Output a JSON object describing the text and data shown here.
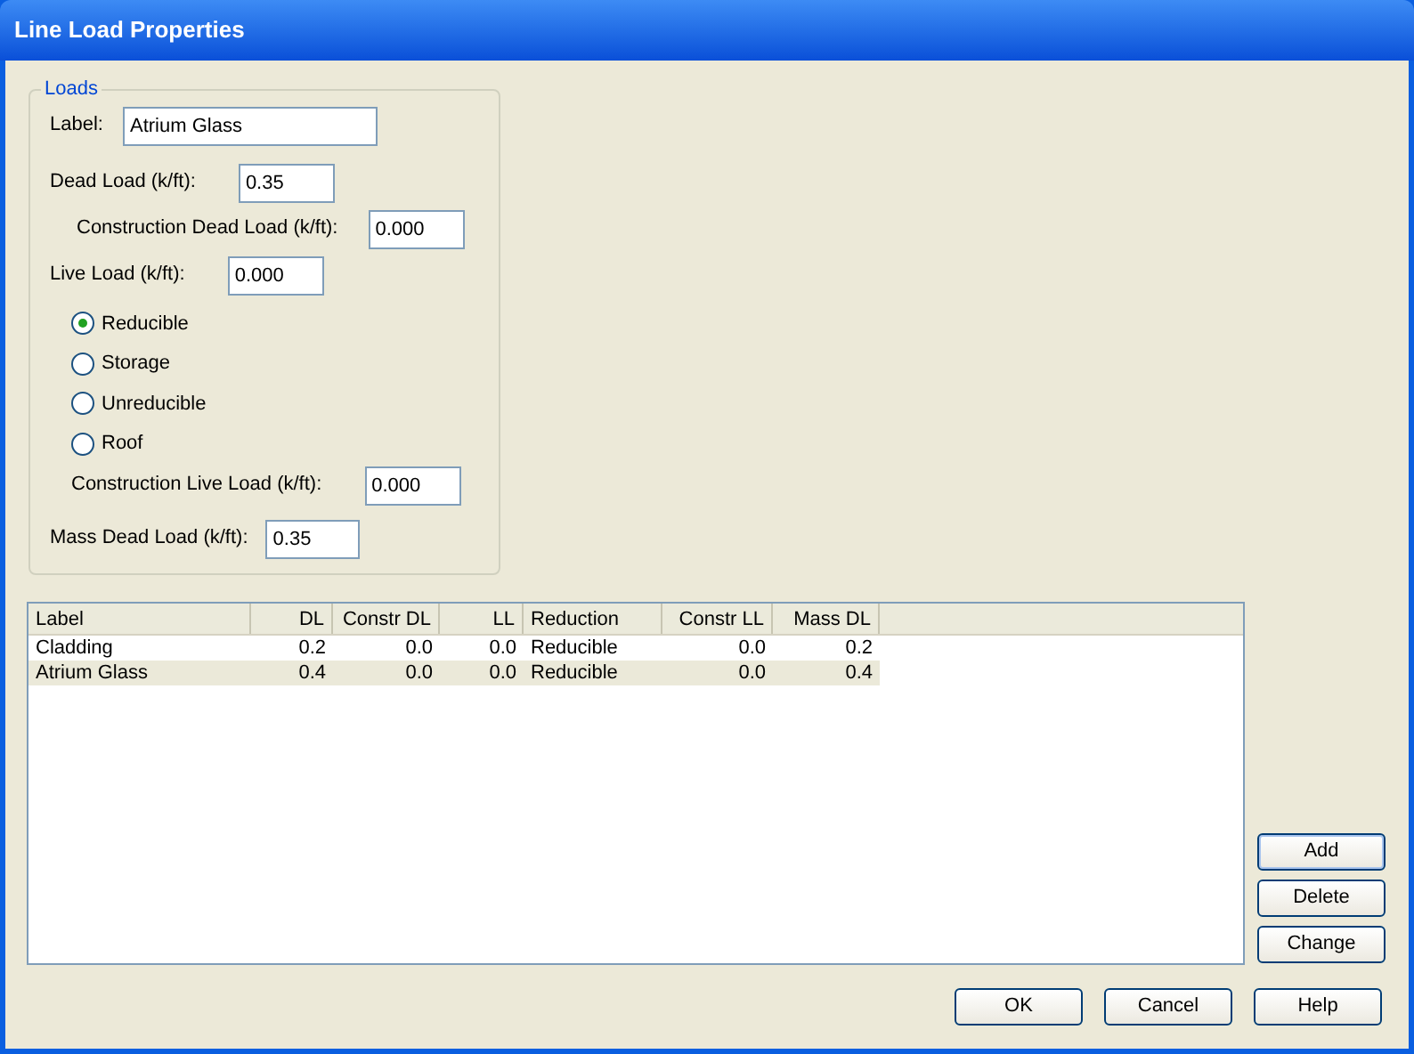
{
  "window": {
    "title": "Line Load Properties"
  },
  "loads": {
    "legend": "Loads",
    "label": {
      "label": "Label:",
      "value": "Atrium Glass"
    },
    "dead_load": {
      "label": "Dead Load (k/ft):",
      "value": "0.35"
    },
    "construction_dead_load": {
      "label": "Construction Dead Load (k/ft):",
      "value": "0.000"
    },
    "live_load": {
      "label": "Live Load (k/ft):",
      "value": "0.000"
    },
    "reduction": [
      {
        "label": "Reducible",
        "selected": true
      },
      {
        "label": "Storage",
        "selected": false
      },
      {
        "label": "Unreducible",
        "selected": false
      },
      {
        "label": "Roof",
        "selected": false
      }
    ],
    "construction_live_load": {
      "label": "Construction Live Load (k/ft):",
      "value": "0.000"
    },
    "mass_dead_load": {
      "label": "Mass Dead Load (k/ft):",
      "value": "0.35"
    }
  },
  "table": {
    "columns": [
      "Label",
      "DL",
      "Constr DL",
      "LL",
      "Reduction",
      "Constr LL",
      "Mass DL"
    ],
    "rows": [
      {
        "cells": [
          "Cladding",
          "0.2",
          "0.0",
          "0.0",
          "Reducible",
          "0.0",
          "0.2"
        ],
        "selected": false
      },
      {
        "cells": [
          "Atrium Glass",
          "0.4",
          "0.0",
          "0.0",
          "Reducible",
          "0.0",
          "0.4"
        ],
        "selected": true
      }
    ]
  },
  "side_buttons": [
    "Add",
    "Delete",
    "Change"
  ],
  "buttons": [
    "OK",
    "Cancel",
    "Help"
  ]
}
